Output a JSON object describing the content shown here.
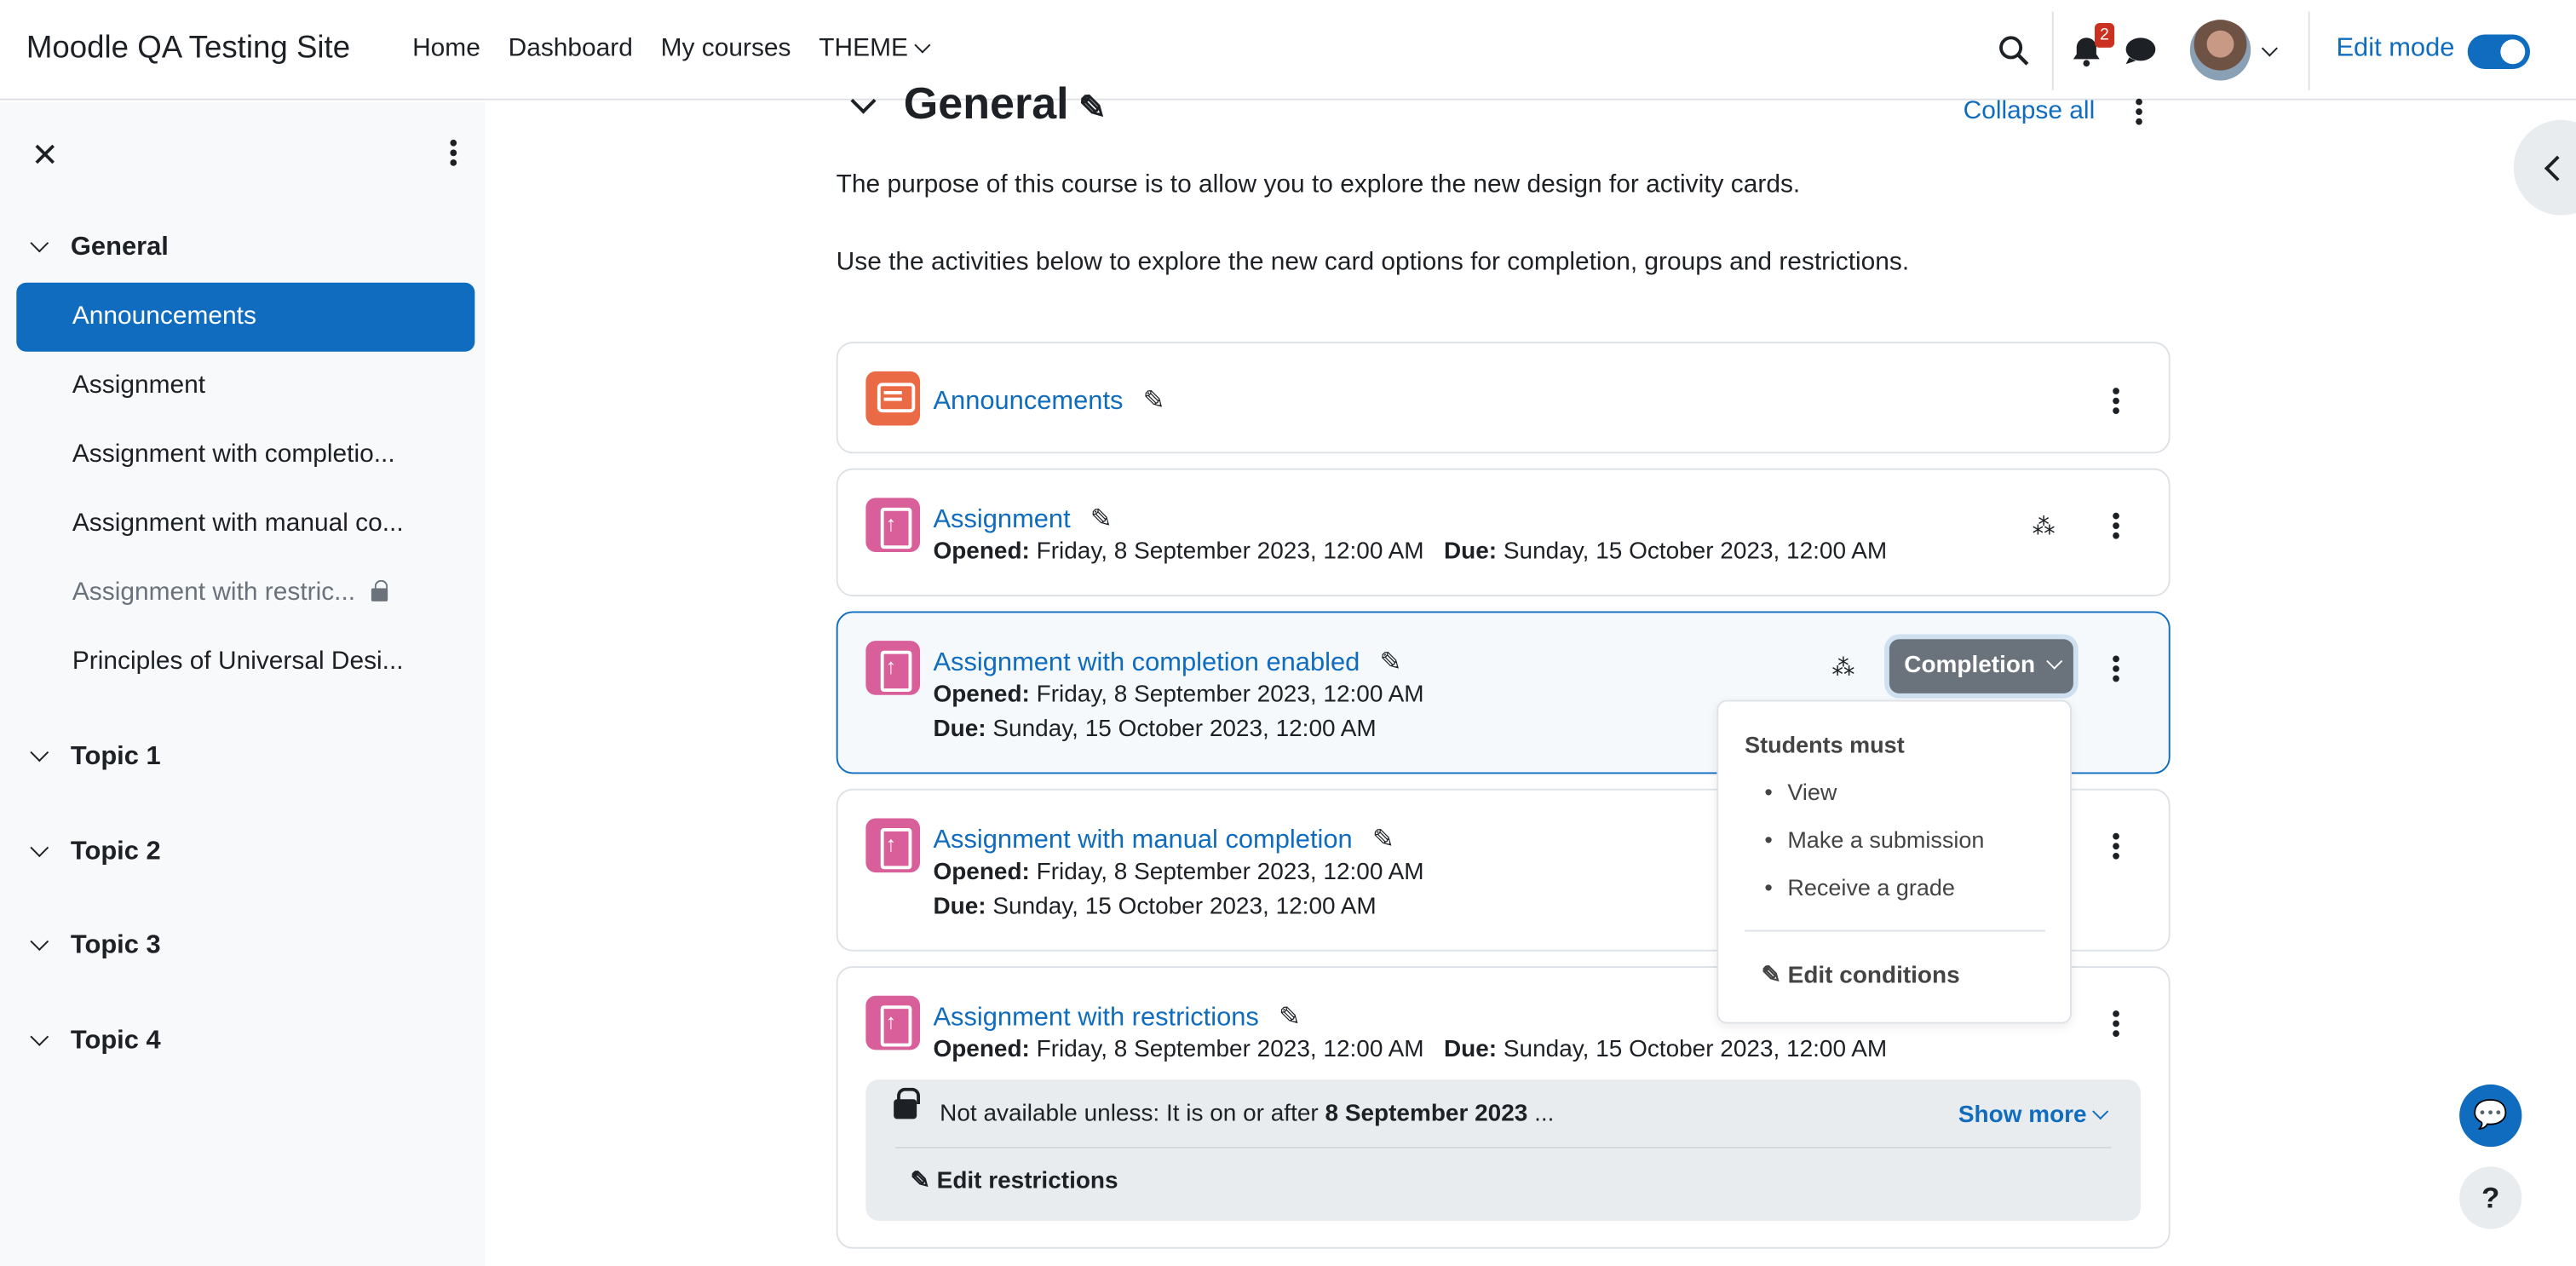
{
  "navbar": {
    "site_name": "Moodle QA Testing Site",
    "links": [
      "Home",
      "Dashboard",
      "My courses",
      "THEME"
    ],
    "notification_count": "2",
    "edit_mode_label": "Edit mode"
  },
  "drawer": {
    "sections": [
      {
        "label": "General"
      },
      {
        "label": "Topic 1"
      },
      {
        "label": "Topic 2"
      },
      {
        "label": "Topic 3"
      },
      {
        "label": "Topic 4"
      }
    ],
    "items": [
      "Announcements",
      "Assignment",
      "Assignment with completio...",
      "Assignment with manual co...",
      "Assignment with restric...",
      "Principles of Universal Desi..."
    ]
  },
  "main": {
    "section_title": "General",
    "collapse_all": "Collapse all",
    "intro_1": "The purpose of this course is to allow you to explore the new design for activity cards.",
    "intro_2": "Use the activities below to explore the new card options for completion, groups and restrictions.",
    "activities": [
      {
        "title": "Announcements"
      },
      {
        "title": "Assignment",
        "opened_label": "Opened:",
        "opened": "Friday, 8 September 2023, 12:00 AM",
        "due_label": "Due:",
        "due": "Sunday, 15 October 2023, 12:00 AM"
      },
      {
        "title": "Assignment with completion enabled",
        "opened_label": "Opened:",
        "opened": "Friday, 8 September 2023, 12:00 AM",
        "due_label": "Due:",
        "due": "Sunday, 15 October 2023, 12:00 AM"
      },
      {
        "title": "Assignment with manual completion",
        "opened_label": "Opened:",
        "opened": "Friday, 8 September 2023, 12:00 AM",
        "due_label": "Due:",
        "due": "Sunday, 15 October 2023, 12:00 AM"
      },
      {
        "title": "Assignment with restrictions",
        "opened_label": "Opened:",
        "opened": "Friday, 8 September 2023, 12:00 AM",
        "due_label": "Due:",
        "due": "Sunday, 15 October 2023, 12:00 AM"
      }
    ],
    "completion_button": "Completion",
    "completion_dropdown": {
      "heading": "Students must",
      "conditions": [
        "View",
        "Make a submission",
        "Receive a grade"
      ],
      "edit": "Edit conditions"
    },
    "restriction": {
      "text_prefix": "Not available unless: It is on or after ",
      "text_bold": "8 September 2023",
      "text_suffix": " ...",
      "show_more": "Show more",
      "edit": "Edit restrictions"
    }
  },
  "colors": {
    "accent": "#0f6cbf",
    "forum_icon": "#eb6a46",
    "assign_icon": "#d85f99"
  }
}
